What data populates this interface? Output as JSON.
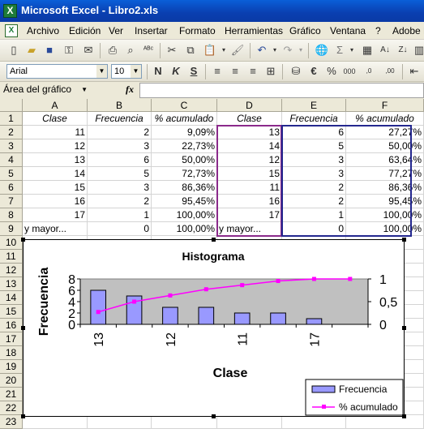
{
  "window": {
    "title": "Microsoft Excel - Libro2.xls",
    "app_icon": "excel-icon"
  },
  "menu": [
    "Archivo",
    "Edición",
    "Ver",
    "Insertar",
    "Formato",
    "Herramientas",
    "Gráfico",
    "Ventana",
    "?",
    "Adobe PDF"
  ],
  "format_toolbar": {
    "font": "Arial",
    "size": "10"
  },
  "formula_bar": {
    "name_box": "Área del gráfico",
    "fx": "fx",
    "value": ""
  },
  "columns": [
    "A",
    "B",
    "C",
    "D",
    "E",
    "F"
  ],
  "rows": [
    "1",
    "2",
    "3",
    "4",
    "5",
    "6",
    "7",
    "8",
    "9",
    "10",
    "11",
    "12",
    "13",
    "14",
    "15",
    "16",
    "17",
    "18",
    "19",
    "20",
    "21",
    "22",
    "23"
  ],
  "table": [
    [
      "Clase",
      "Frecuencia",
      "% acumulado",
      "Clase",
      "Frecuencia",
      "% acumulado"
    ],
    [
      "11",
      "2",
      "9,09%",
      "13",
      "6",
      "27,27%"
    ],
    [
      "12",
      "3",
      "22,73%",
      "14",
      "5",
      "50,00%"
    ],
    [
      "13",
      "6",
      "50,00%",
      "12",
      "3",
      "63,64%"
    ],
    [
      "14",
      "5",
      "72,73%",
      "15",
      "3",
      "77,27%"
    ],
    [
      "15",
      "3",
      "86,36%",
      "11",
      "2",
      "86,36%"
    ],
    [
      "16",
      "2",
      "95,45%",
      "16",
      "2",
      "95,45%"
    ],
    [
      "17",
      "1",
      "100,00%",
      "17",
      "1",
      "100,00%"
    ],
    [
      "y mayor...",
      "0",
      "100,00%",
      "y mayor...",
      "0",
      "100,00%"
    ]
  ],
  "colors": {
    "bar_fill": "#9999ff",
    "line": "#ff00ff",
    "plot_area": "#c0c0c0",
    "selection_purple": "#8b2a8b",
    "selection_blue": "#24288f"
  },
  "chart_data": {
    "type": "bar",
    "title": "Histograma",
    "xlabel": "Clase",
    "ylabel": "Frecuencia",
    "categories": [
      "13",
      "14",
      "12",
      "15",
      "11",
      "16",
      "17",
      "y mayor..."
    ],
    "x_tick_labels_shown": [
      "13",
      "12",
      "11",
      "17"
    ],
    "series": [
      {
        "name": "Frecuencia",
        "type": "bar",
        "axis": "left",
        "values": [
          6,
          5,
          3,
          3,
          2,
          2,
          1,
          0
        ]
      },
      {
        "name": "% acumulado",
        "type": "line",
        "axis": "right",
        "values": [
          0.2727,
          0.5,
          0.6364,
          0.7727,
          0.8636,
          0.9545,
          1.0,
          1.0
        ]
      }
    ],
    "ylim": [
      0,
      8
    ],
    "y_ticks": [
      "0",
      "2",
      "4",
      "6",
      "8"
    ],
    "y2lim": [
      0,
      1
    ],
    "y2_ticks": [
      "0",
      "0,5",
      "1"
    ],
    "legend": "bottom-right",
    "grid": false
  }
}
